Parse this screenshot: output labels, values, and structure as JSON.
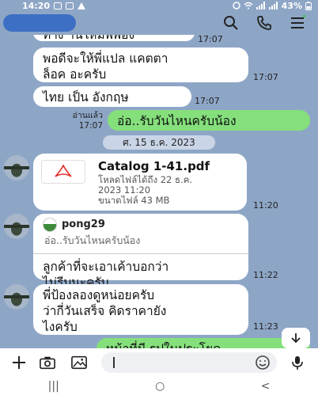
{
  "status_bar": {
    "time": "14:20",
    "battery": "43%"
  },
  "header": {
    "icons": [
      "search-icon",
      "phone-icon",
      "menu-icon"
    ]
  },
  "messages": [
    {
      "id": "m1",
      "text": "ท่าง านใหม่พิพิอง",
      "time": "17:07"
    },
    {
      "id": "m2",
      "lines": [
        "พอดีจะให้พี่แปล แคตตา",
        "ล็อค อะครับ"
      ],
      "time": "17:07"
    },
    {
      "id": "m3",
      "text": "ไทย เป็น อังกฤษ",
      "time": "17:07"
    },
    {
      "id": "m4",
      "text": "อ่อ..รับวันไหนครับน้อง",
      "read": "อ่านแล้ว",
      "time": "17:07",
      "outgoing": true
    }
  ],
  "date_separator": "ศ. 15 ธ.ค. 2023",
  "file_message": {
    "title": "Catalog 1-41.pdf",
    "download_until_1": "โหลดไฟล์ได้ถึง 22 ธ.ค.",
    "download_until_2": "2023 11:20",
    "size": "ขนาดไฟล์ 43 MB",
    "time": "11:20"
  },
  "reply_message": {
    "reply_name": "pong29",
    "reply_quote": "อ่อ..รับวันไหนครับน้อง",
    "lines": [
      "ลูกค้าที่จะเอาเค้าบอกว่า",
      "ไม่รีบนะครับ"
    ],
    "time": "11:22"
  },
  "message_5": {
    "lines": [
      "พี่ป้องลองดูหน่อยครับ",
      "ว่ากี่วันเสร็จ คิดราคายัง",
      "ไงครับ"
    ],
    "time": "11:23"
  },
  "message_6_partial": {
    "text": "หน้าที่มี รูปในประโยค",
    "outgoing": true
  },
  "input": {
    "placeholder": ""
  },
  "nav": {
    "recents": "|||",
    "home": "○",
    "back": "<"
  }
}
